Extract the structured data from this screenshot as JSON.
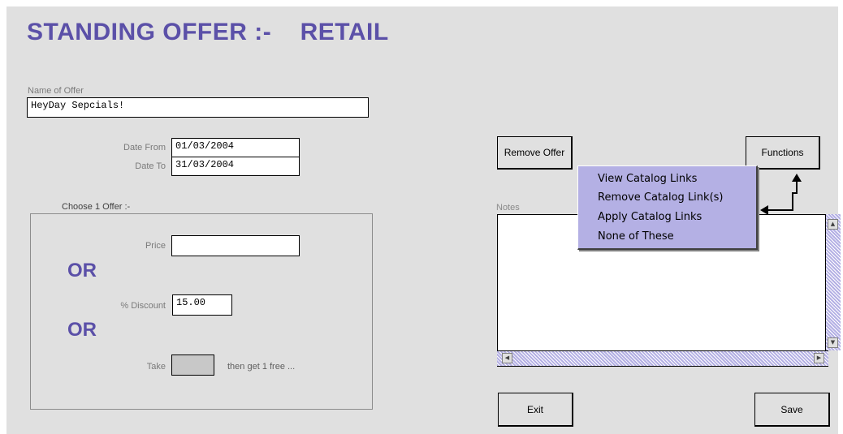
{
  "title": "STANDING OFFER :-    RETAIL",
  "offer_name": {
    "label": "Name of Offer",
    "value": "HeyDay Sepcials!"
  },
  "dates": {
    "from_label": "Date From",
    "from_value": "01/03/2004",
    "to_label": "Date To",
    "to_value": "31/03/2004"
  },
  "choose": {
    "title": "Choose 1 Offer :-",
    "price_label": "Price",
    "price_value": "",
    "or1": "OR",
    "discount_label": "% Discount",
    "discount_value": "15.00",
    "or2": "OR",
    "take_label": "Take",
    "take_value": "",
    "free_label": "then get 1 free ..."
  },
  "buttons": {
    "remove_offer": "Remove Offer",
    "functions": "Functions",
    "exit": "Exit",
    "save": "Save"
  },
  "functions_menu": {
    "items": [
      "View Catalog Links",
      "Remove Catalog Link(s)",
      "Apply Catalog Links",
      "None of These"
    ]
  },
  "notes": {
    "label": "Notes",
    "value": ""
  },
  "colors": {
    "accent": "#5b50a8",
    "menu_bg": "#b4b0e4",
    "panel_bg": "#e0e0e0"
  }
}
